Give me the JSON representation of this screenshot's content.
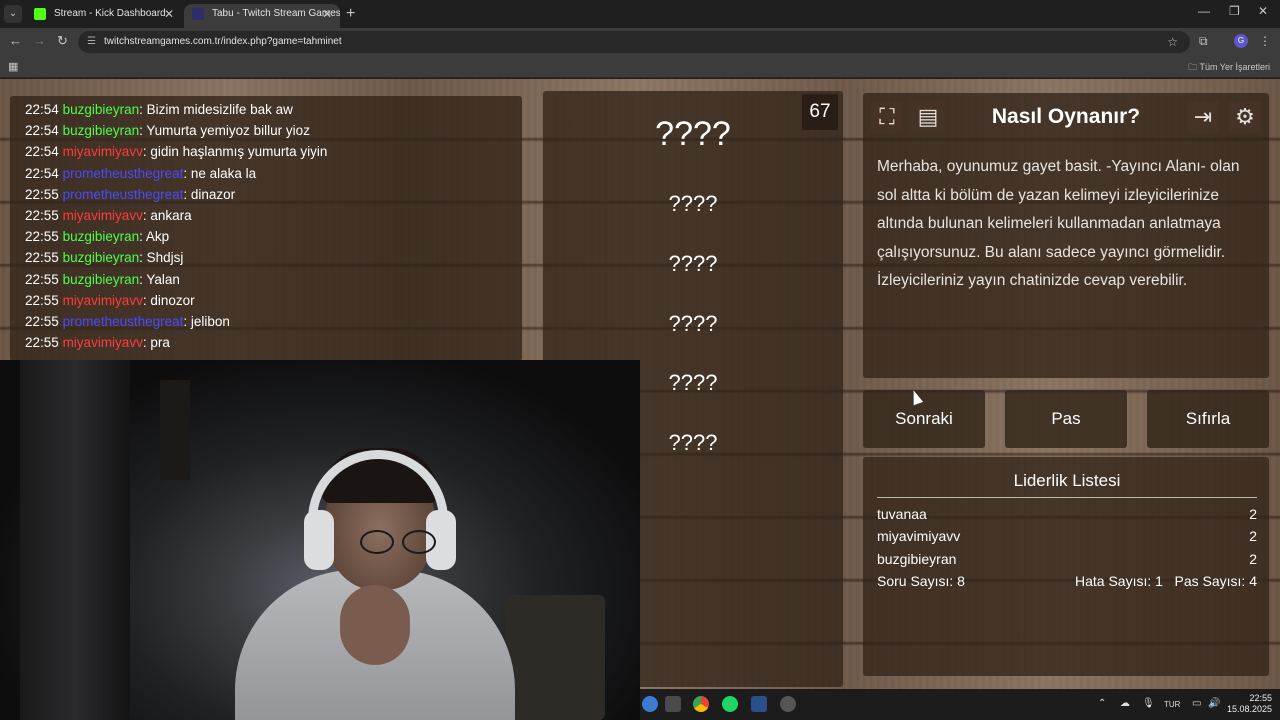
{
  "browser": {
    "tabs": [
      {
        "title": "Stream - Kick Dashboard",
        "favicon_color": "#53fc18"
      },
      {
        "title": "Tabu - Twitch Stream Games",
        "favicon_color": "#2d2d6a"
      }
    ],
    "url": "twitchstreamgames.com.tr/index.php?game=tahminet",
    "bookmarks_all": "Tüm Yer İşaretleri",
    "profile_initial": "G"
  },
  "chat": {
    "messages": [
      {
        "time": "22:54",
        "user": "buzgibieyran",
        "color": "#4cff4c",
        "text": ": Bizim midesizlife bak aw"
      },
      {
        "time": "22:54",
        "user": "buzgibieyran",
        "color": "#4cff4c",
        "text": ": Yumurta yemiyoz billur yioz"
      },
      {
        "time": "22:54",
        "user": "miyavimiyavv",
        "color": "#ff3b3b",
        "text": ": gidin haşlanmış yumurta yiyin"
      },
      {
        "time": "22:54",
        "user": "prometheusthegreat",
        "color": "#4a4aff",
        "text": ": ne alaka la"
      },
      {
        "time": "22:55",
        "user": "prometheusthegreat",
        "color": "#4a4aff",
        "text": ": dinazor"
      },
      {
        "time": "22:55",
        "user": "miyavimiyavv",
        "color": "#ff3b3b",
        "text": ": ankara"
      },
      {
        "time": "22:55",
        "user": "buzgibieyran",
        "color": "#4cff4c",
        "text": ": Akp"
      },
      {
        "time": "22:55",
        "user": "buzgibieyran",
        "color": "#4cff4c",
        "text": ": Shdjsj"
      },
      {
        "time": "22:55",
        "user": "buzgibieyran",
        "color": "#4cff4c",
        "text": ": Yalan"
      },
      {
        "time": "22:55",
        "user": "miyavimiyavv",
        "color": "#ff3b3b",
        "text": ": dinozor"
      },
      {
        "time": "22:55",
        "user": "prometheusthegreat",
        "color": "#4a4aff",
        "text": ": jelibon"
      },
      {
        "time": "22:55",
        "user": "miyavimiyavv",
        "color": "#ff3b3b",
        "text": ": pra"
      }
    ]
  },
  "words": {
    "main": "????",
    "forbidden": [
      "????",
      "????",
      "????",
      "????",
      "????"
    ]
  },
  "timer": "67",
  "howto": {
    "title": "Nasıl Oynanır?",
    "text": "Merhaba, oyunumuz gayet basit. -Yayıncı Alanı- olan sol altta ki bölüm de yazan kelimeyi izleyicilerinize altında bulunan kelimeleri kullanmadan anlatmaya çalışıyorsunuz. Bu alanı sadece yayıncı görmelidir. İzleyicileriniz yayın chatinizde cevap verebilir.",
    "icons": [
      "fullscreen-icon",
      "notes-icon",
      "exit-icon",
      "settings-gear-icon"
    ]
  },
  "buttons": {
    "next": "Sonraki",
    "pass": "Pas",
    "reset": "Sıfırla"
  },
  "leaderboard": {
    "title": "Liderlik Listesi",
    "rows": [
      {
        "name": "tuvanaa",
        "score": "2"
      },
      {
        "name": "miyavimiyavv",
        "score": "2"
      },
      {
        "name": "buzgibieyran",
        "score": "2"
      }
    ],
    "question_count": "Soru Sayısı: 8",
    "error_count": "Hata Sayısı: 1",
    "pass_count": "Pas Sayısı: 4"
  },
  "taskbar": {
    "lang": "TUR",
    "time": "22:55",
    "date": "15.08.2025"
  }
}
